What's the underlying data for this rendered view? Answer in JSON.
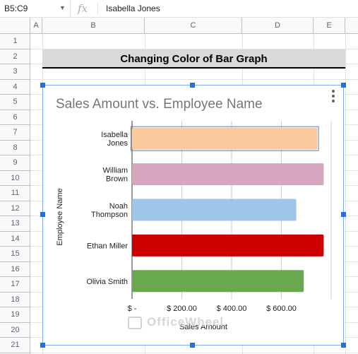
{
  "formula_bar": {
    "name_box": "B5:C9",
    "fx": "fx",
    "value": "Isabella Jones"
  },
  "columns": [
    "A",
    "B",
    "C",
    "D",
    "E"
  ],
  "rows": [
    "1",
    "2",
    "3",
    "4",
    "5",
    "6",
    "7",
    "8",
    "9",
    "10",
    "11",
    "12",
    "13",
    "14",
    "15",
    "16",
    "17",
    "18",
    "19",
    "20",
    "21"
  ],
  "sheet_title": "Changing Color of Bar Graph",
  "watermark": "OfficeWheel",
  "chart_data": {
    "type": "bar",
    "orientation": "horizontal",
    "title": "Sales Amount vs. Employee Name",
    "xlabel": "Sales Amount",
    "ylabel": "Employee Name",
    "categories": [
      {
        "lines": [
          "Isabella",
          "Jones"
        ],
        "value": 745,
        "color": "#f9cb9c",
        "selected": true
      },
      {
        "lines": [
          "William",
          "Brown"
        ],
        "value": 770,
        "color": "#d5a6bd",
        "selected": false
      },
      {
        "lines": [
          "Noah",
          "Thompson"
        ],
        "value": 660,
        "color": "#9fc5e8",
        "selected": false
      },
      {
        "lines": [
          "Ethan Miller"
        ],
        "value": 770,
        "color": "#cc0000",
        "selected": false
      },
      {
        "lines": [
          "Olivia Smith"
        ],
        "value": 690,
        "color": "#6aa84f",
        "selected": false
      }
    ],
    "x_ticks": [
      {
        "value": 0,
        "label": "$ -"
      },
      {
        "value": 200,
        "label": "$ 200.00"
      },
      {
        "value": 400,
        "label": "$ 400.00"
      },
      {
        "value": 600,
        "label": "$ 600.00"
      }
    ],
    "xlim": [
      0,
      800
    ],
    "grid": true,
    "legend": "none"
  }
}
